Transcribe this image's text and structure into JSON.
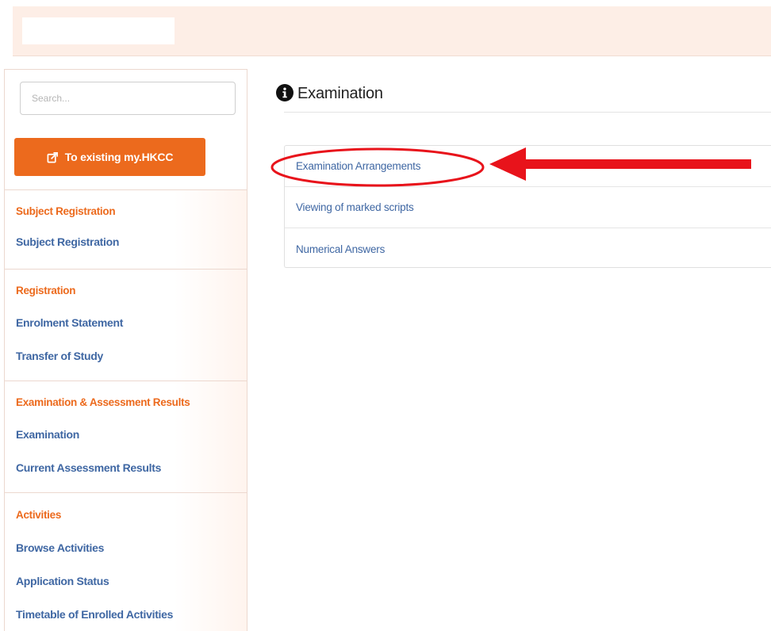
{
  "search": {
    "placeholder": "Search..."
  },
  "sidebar": {
    "existing_button_label": "To existing my.HKCC",
    "sections": [
      {
        "title": "Subject Registration",
        "links": [
          "Subject Registration"
        ]
      },
      {
        "title": "Registration",
        "links": [
          "Enrolment Statement",
          "Transfer of Study"
        ]
      },
      {
        "title": "Examination & Assessment Results",
        "links": [
          "Examination",
          "Current Assessment Results"
        ]
      },
      {
        "title": "Activities",
        "links": [
          "Browse Activities",
          "Application Status",
          "Timetable of Enrolled Activities"
        ]
      }
    ]
  },
  "main": {
    "title": "Examination",
    "items": [
      "Examination Arrangements",
      "Viewing of marked scripts",
      "Numerical Answers"
    ]
  },
  "colors": {
    "accent_orange": "#ec6a1d",
    "link_blue": "#3f67a3",
    "header_bg": "#fdeee6",
    "annotation_red": "#e8131b"
  },
  "icons": {
    "button": "external-link-icon",
    "title": "info-icon"
  }
}
